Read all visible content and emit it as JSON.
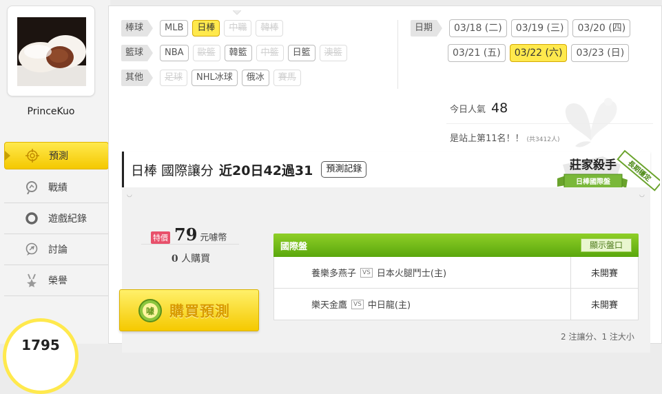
{
  "user": {
    "name": "PrinceKuo"
  },
  "sidebar": {
    "items": [
      {
        "label": "預測",
        "icon": "target-icon",
        "active": true
      },
      {
        "label": "戰績",
        "icon": "chart-icon",
        "active": false
      },
      {
        "label": "遊戲紀錄",
        "icon": "circle-icon",
        "active": false
      },
      {
        "label": "討論",
        "icon": "chat-icon",
        "active": false
      },
      {
        "label": "榮譽",
        "icon": "medal-icon",
        "active": false
      }
    ],
    "gauge_value": "1795"
  },
  "filters": {
    "rows": [
      {
        "category": "棒球",
        "options": [
          {
            "label": "MLB",
            "state": "normal"
          },
          {
            "label": "日棒",
            "state": "selected"
          },
          {
            "label": "中職",
            "state": "disabled"
          },
          {
            "label": "韓棒",
            "state": "disabled"
          }
        ]
      },
      {
        "category": "籃球",
        "options": [
          {
            "label": "NBA",
            "state": "normal"
          },
          {
            "label": "歐籃",
            "state": "disabled"
          },
          {
            "label": "韓籃",
            "state": "normal"
          },
          {
            "label": "中籃",
            "state": "disabled"
          },
          {
            "label": "日籃",
            "state": "normal"
          },
          {
            "label": "澳籃",
            "state": "disabled"
          }
        ]
      },
      {
        "category": "其他",
        "options": [
          {
            "label": "足球",
            "state": "disabled"
          },
          {
            "label": "NHL冰球",
            "state": "normal"
          },
          {
            "label": "俄冰",
            "state": "normal"
          },
          {
            "label": "賽馬",
            "state": "disabled"
          }
        ]
      }
    ]
  },
  "dates": {
    "category": "日期",
    "row1": [
      {
        "label": "03/18 (二)",
        "selected": false
      },
      {
        "label": "03/19 (三)",
        "selected": false
      },
      {
        "label": "03/20 (四)",
        "selected": false
      }
    ],
    "row2": [
      {
        "label": "03/21 (五)",
        "selected": false
      },
      {
        "label": "03/22 (六)",
        "selected": true
      },
      {
        "label": "03/23 (日)",
        "selected": false
      }
    ]
  },
  "stats": {
    "popularity_label": "今日人氣",
    "popularity_value": "48",
    "rank_text": "是站上第11名！！",
    "rank_total": "(共3412人)"
  },
  "header": {
    "title": "日棒 國際讓分",
    "record": "近20日42過31",
    "record_button": "預測記錄",
    "badge_title": "莊家殺手",
    "badge_subtitle": "日棒國際盤",
    "badge_ribbon": "長期穩定"
  },
  "purchase": {
    "tag": "特價",
    "price": "79",
    "unit": "元噱幣",
    "buyers_count": "0",
    "buyers_label": "人購買",
    "button_label": "購買預測",
    "button_icon_text": "噱"
  },
  "odds": {
    "title": "國際盤",
    "show_button": "顯示盤口",
    "vs": "VS",
    "rows": [
      {
        "away": "養樂多燕子",
        "home": "日本火腿鬥士(主)",
        "status": "未開賽"
      },
      {
        "away": "樂天金鷹",
        "home": "中日龍(主)",
        "status": "未開賽"
      }
    ],
    "summary": "2 注讓分、1 注大小"
  },
  "colors": {
    "accent": "#ffe94d",
    "green": "#5aa70d",
    "tag_pink": "#e8506b"
  }
}
